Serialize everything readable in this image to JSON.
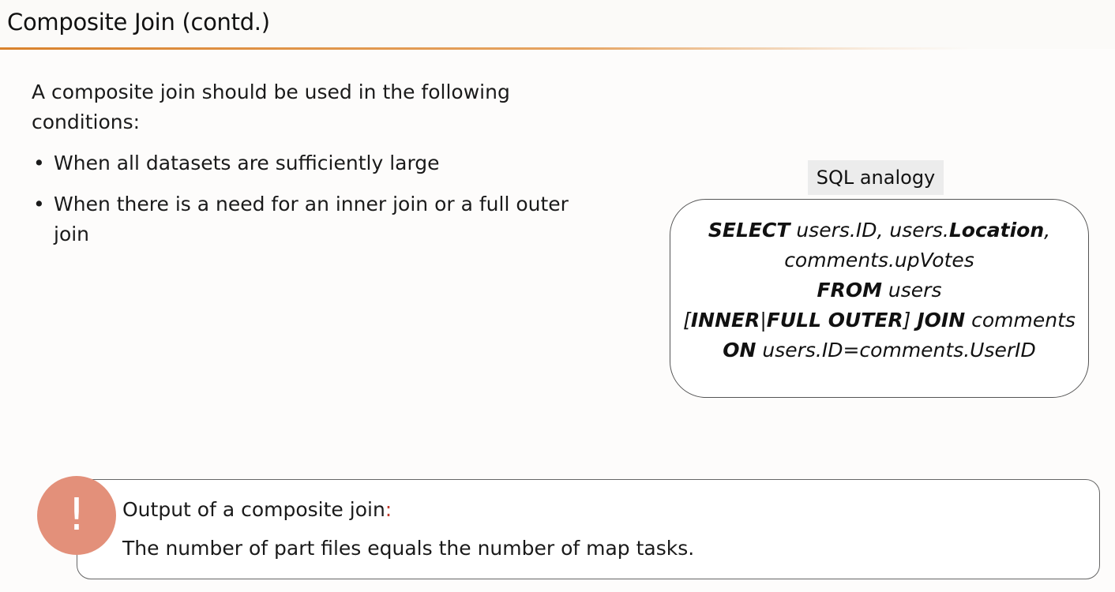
{
  "slide": {
    "title": "Composite Join (contd.)",
    "intro": "A composite join should be used in the following conditions:",
    "bullets": [
      "When all datasets are sufficiently large",
      "When there is a need for an inner join or a full outer join"
    ],
    "bullet_glyph": "•"
  },
  "sql": {
    "label": "SQL analogy",
    "line1_kw": "SELECT",
    "line1_a": " users.ID, users.",
    "line1_kw2": "Location",
    "line1_b": ",",
    "line2": "comments.upVotes",
    "line3_kw": "FROM",
    "line3_a": " users",
    "line4_a": "[",
    "line4_kw1": "INNER",
    "line4_b": "|",
    "line4_kw2": "FULL OUTER",
    "line4_c": "] ",
    "line4_kw3": "JOIN",
    "line4_d": " comments",
    "line5_kw": "ON",
    "line5_a": " users.ID=comments.UserID"
  },
  "note": {
    "icon_glyph": "!",
    "title": "Output of a composite join",
    "title_colon": ":",
    "body": "The number of part files equals the number of map tasks."
  },
  "colors": {
    "accent_rule": "#d9822c",
    "alert_circle": "#e3907a",
    "colon_red": "#c0392b"
  }
}
